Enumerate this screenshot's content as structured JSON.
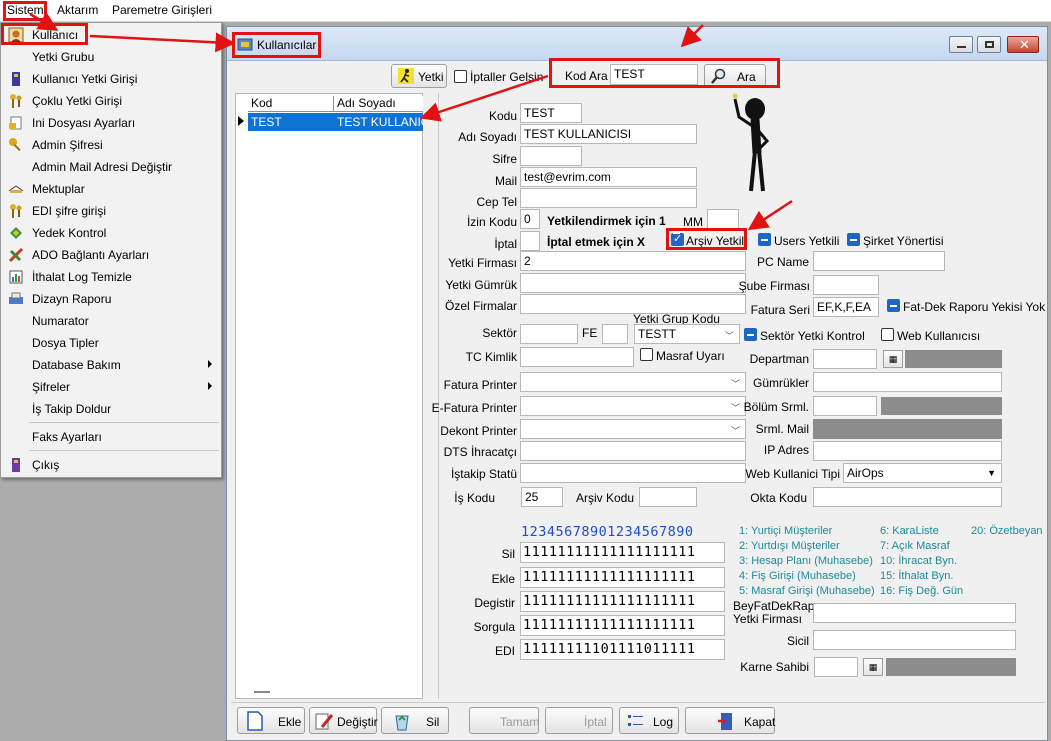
{
  "menubar": {
    "items": [
      "Sistem",
      "Aktarım",
      "Paremetre Girişleri"
    ]
  },
  "sistem_menu": {
    "items": [
      {
        "label": "Kullanıcı",
        "icon": "user-icon"
      },
      {
        "label": "Yetki Grubu",
        "icon": ""
      },
      {
        "label": "Kullanıcı Yetki Girişi",
        "icon": "book-icon"
      },
      {
        "label": "Çoklu Yetki Girişi",
        "icon": "keys-icon"
      },
      {
        "label": "Ini Dosyası  Ayarları",
        "icon": "settings-file-icon"
      },
      {
        "label": "Admin Şifresi",
        "icon": "key-icon"
      },
      {
        "label": "Admin Mail Adresi Değiştir",
        "icon": ""
      },
      {
        "label": "Mektuplar",
        "icon": "letter-icon"
      },
      {
        "label": "EDI şifre girişi",
        "icon": "keys-icon"
      },
      {
        "label": "Yedek Kontrol",
        "icon": "backup-icon"
      },
      {
        "label": "ADO Bağlantı Ayarları",
        "icon": "connection-icon"
      },
      {
        "label": "İthalat Log Temizle",
        "icon": "clean-icon"
      },
      {
        "label": "Dizayn Raporu",
        "icon": "report-icon"
      },
      {
        "label": "Numarator",
        "icon": ""
      },
      {
        "label": "Dosya Tipler",
        "icon": ""
      },
      {
        "label": "Database Bakım",
        "icon": "",
        "submenu": true
      },
      {
        "label": "Şifreler",
        "icon": "",
        "submenu": true
      },
      {
        "label": "İş Takip Doldur",
        "icon": ""
      },
      {
        "label": "Faks Ayarları",
        "icon": ""
      },
      {
        "label": "Çıkış",
        "icon": "exit-icon"
      }
    ]
  },
  "window": {
    "title": "Kullanıcılar"
  },
  "toolbar": {
    "yetki_label": "Yetki",
    "iptaller_label": "İptaller Gelsin",
    "kod_ara_label": "Kod Ara",
    "kod_ara_value": "TEST",
    "ara_label": "Ara"
  },
  "grid": {
    "headers": [
      "Kod",
      "Adı Soyadı"
    ],
    "rows": [
      [
        "TEST",
        "TEST KULLANICI"
      ]
    ]
  },
  "form": {
    "kodu": {
      "label": "Kodu",
      "value": "TEST"
    },
    "adi_soyadi": {
      "label": "Adı Soyadı",
      "value": "TEST KULLANICISI"
    },
    "sifre": {
      "label": "Sifre",
      "value": ""
    },
    "mail": {
      "label": "Mail",
      "value": "test@evrim.com"
    },
    "cep_tel": {
      "label": "Cep Tel",
      "value": ""
    },
    "izin_kodu": {
      "label": "İzin Kodu",
      "value": "0"
    },
    "yetkilendirmek": "Yetkilendirmek için 1",
    "mm": {
      "label": "MM",
      "value": ""
    },
    "iptal": {
      "label": "İptal",
      "value": ""
    },
    "iptal_etmek": "İptal etmek için X",
    "arsiv_yetkili": "Arşiv Yetkili",
    "users_yetkili": "Users Yetkili",
    "sirket_yonetimi": "Şirket Yönertisi",
    "yetki_firmasi": {
      "label": "Yetki Firması",
      "value": "2"
    },
    "pc_name": {
      "label": "PC Name",
      "value": ""
    },
    "yetki_gumruk": {
      "label": "Yetki Gümrük",
      "value": ""
    },
    "sube_firmasi": {
      "label": "Şube Firması",
      "value": ""
    },
    "ozel_firmalar": {
      "label": "Özel Firmalar",
      "value": ""
    },
    "fatura_seri": {
      "label": "Fatura Seri",
      "value": "EF,K,F,EA"
    },
    "fat_dek": "Fat-Dek Raporu Yekisi Yok",
    "sektor": {
      "label": "Sektör",
      "value": ""
    },
    "fe": {
      "label": "FE",
      "value": ""
    },
    "yetki_grup_kodu": {
      "label": "Yetki Grup Kodu",
      "value": "TESTT"
    },
    "sektor_yetki_kontrol": "Sektör Yetki Kontrol",
    "web_kullanicisi": "Web Kullanıcısı",
    "tc_kimlik": {
      "label": "TC Kimlik",
      "value": ""
    },
    "masraf_uyari": "Masraf Uyarı",
    "departman": {
      "label": "Departman",
      "value": ""
    },
    "fatura_printer": {
      "label": "Fatura Printer",
      "value": ""
    },
    "gumrukler": {
      "label": "Gümrükler",
      "value": ""
    },
    "efatura_printer": {
      "label": "E-Fatura Printer",
      "value": ""
    },
    "bolum_srml": {
      "label": "Bölüm Srml.",
      "value": ""
    },
    "dekont_printer": {
      "label": "Dekont Printer",
      "value": ""
    },
    "srml_mail": {
      "label": "Srml. Mail",
      "value": ""
    },
    "dts_ihracatci": {
      "label": "DTS İhracatçı",
      "value": ""
    },
    "ip_adres": {
      "label": "IP Adres",
      "value": ""
    },
    "istakip_statu": {
      "label": "İştakip Statü",
      "value": ""
    },
    "web_kullanici_tipi": {
      "label": "Web Kullanici Tipi",
      "value": "AirOps"
    },
    "is_kodu": {
      "label": "İş Kodu",
      "value": "25"
    },
    "arsiv_kodu": {
      "label": "Arşiv Kodu",
      "value": ""
    },
    "okta_kodu": {
      "label": "Okta Kodu",
      "value": ""
    },
    "beyfat_label_1": "BeyFatDekRap",
    "beyfat_label_2": "Yetki Firması",
    "beyfat_value": "",
    "sicil": {
      "label": "Sicil",
      "value": ""
    },
    "karne_sahibi": {
      "label": "Karne Sahibi",
      "value": ""
    }
  },
  "perms": {
    "header": "12345678901234567890",
    "rows": [
      {
        "label": "Sil",
        "value": "11111111111111111111"
      },
      {
        "label": "Ekle",
        "value": "11111111111111111111"
      },
      {
        "label": "Degistir",
        "value": "11111111111111111111"
      },
      {
        "label": "Sorgula",
        "value": "11111111111111111111"
      },
      {
        "label": "EDI",
        "value": "11111111101111011111"
      }
    ],
    "legend": [
      "1: Yurtiçi Müşteriler",
      "2: Yurtdışı Müşteriler",
      "3: Hesap Planı (Muhasebe)",
      "4: Fiş Girişi (Muhasebe)",
      "5: Masraf Girişi (Muhasebe)",
      "6: KaraListe",
      "7: Açık Masraf",
      "10: İhracat Byn.",
      "15: İthalat Byn.",
      "16: Fiş Değ. Gün",
      "20: Özetbeyan"
    ]
  },
  "bottom": {
    "ekle": "Ekle",
    "degistir": "Değiştir",
    "sil": "Sil",
    "tamam": "Tamam",
    "iptal": "İptal",
    "log": "Log",
    "kapat": "Kapat"
  },
  "colors": {
    "highlight": "#e31212",
    "selection": "#0e73d3",
    "legend": "#1e8a9a"
  }
}
